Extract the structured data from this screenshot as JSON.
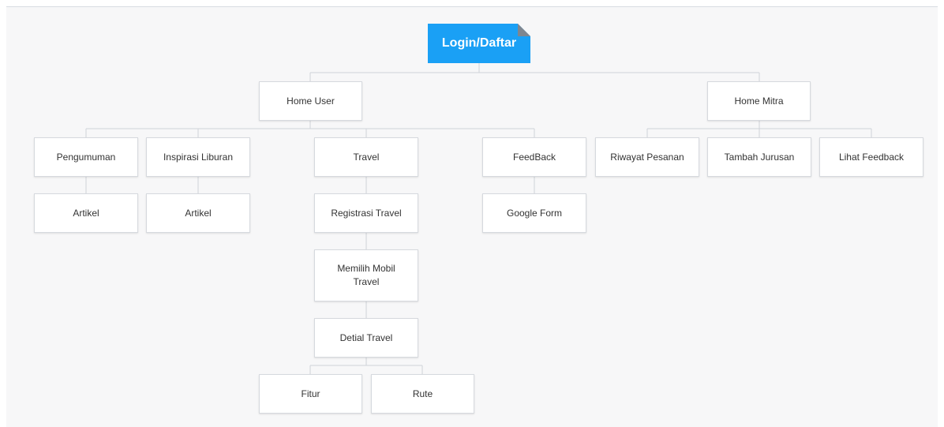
{
  "diagram": {
    "root": {
      "label": "Login/Daftar"
    },
    "home_user": {
      "label": "Home User",
      "pengumuman": {
        "label": "Pengumuman",
        "child": "Artikel"
      },
      "inspirasi": {
        "label": "Inspirasi Liburan",
        "child": "Artikel"
      },
      "travel": {
        "label": "Travel",
        "registrasi": "Registrasi Travel",
        "memilih": "Memilih Mobil Travel",
        "detial": "Detial Travel",
        "fitur": "Fitur",
        "rute": "Rute"
      },
      "feedback": {
        "label": "FeedBack",
        "child": "Google Form"
      }
    },
    "home_mitra": {
      "label": "Home Mitra",
      "riwayat": "Riwayat Pesanan",
      "tambah": "Tambah Jurusan",
      "lihat": "Lihat Feedback"
    }
  },
  "colors": {
    "root_fill": "#1aa0f5",
    "root_fold": "#7f868f",
    "node_border": "#d6d9de",
    "connector": "#cfd3d9",
    "canvas": "#f7f7f8"
  }
}
